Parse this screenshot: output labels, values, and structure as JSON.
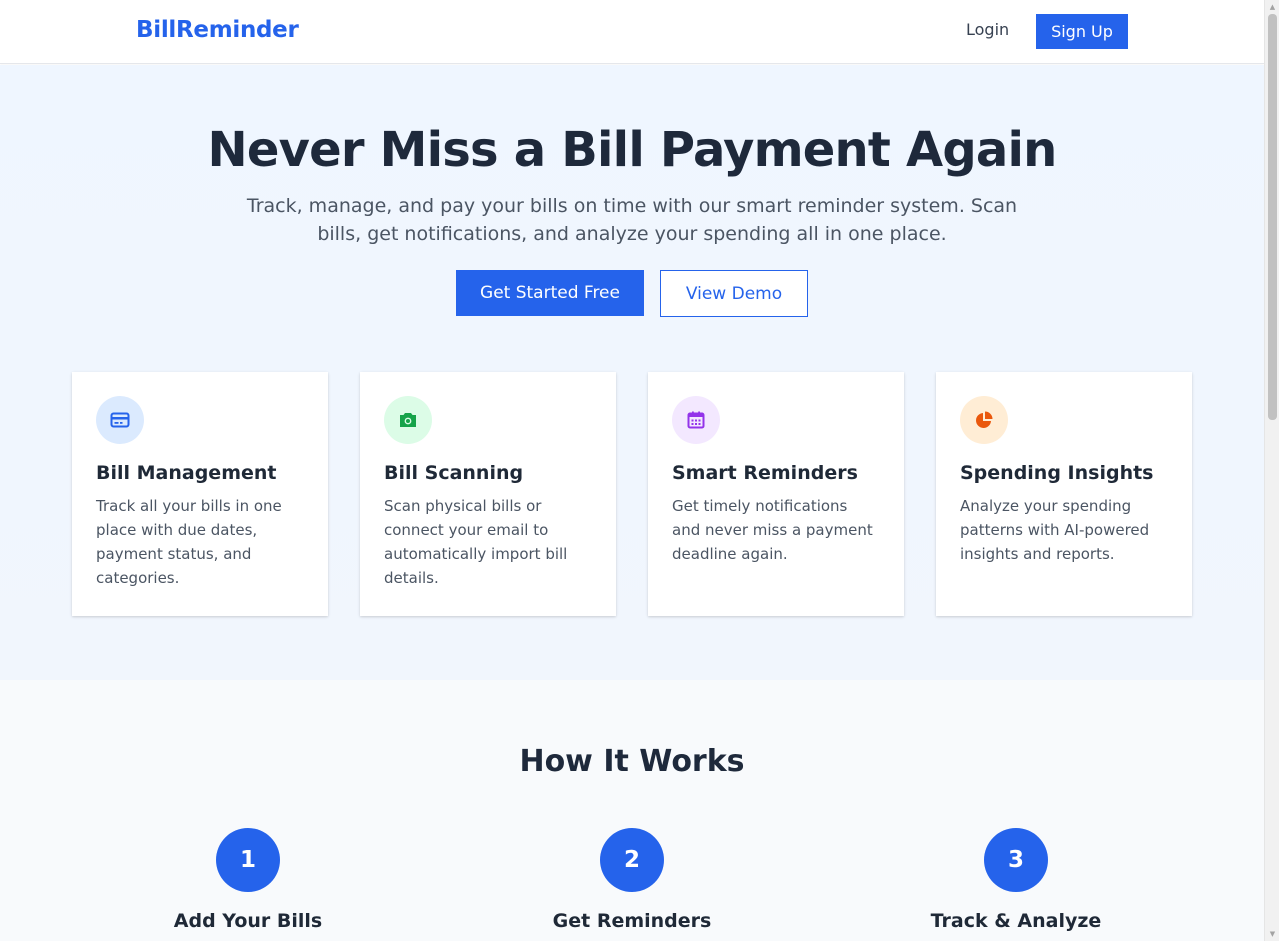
{
  "header": {
    "brand": "BillReminder",
    "login_label": "Login",
    "signup_label": "Sign Up"
  },
  "hero": {
    "title": "Never Miss a Bill Payment Again",
    "subtitle": "Track, manage, and pay your bills on time with our smart reminder system. Scan bills, get notifications, and analyze your spending all in one place.",
    "primary_cta": "Get Started Free",
    "secondary_cta": "View Demo"
  },
  "features": [
    {
      "icon": "credit-card-icon",
      "title": "Bill Management",
      "text": "Track all your bills in one place with due dates, payment status, and categories.",
      "icon_color": "#2563eb",
      "icon_bg": "#dbeafe"
    },
    {
      "icon": "camera-icon",
      "title": "Bill Scanning",
      "text": "Scan physical bills or connect your email to automatically import bill details.",
      "icon_color": "#16a34a",
      "icon_bg": "#dcfce7"
    },
    {
      "icon": "calendar-icon",
      "title": "Smart Reminders",
      "text": "Get timely notifications and never miss a payment deadline again.",
      "icon_color": "#9333ea",
      "icon_bg": "#f3e8ff"
    },
    {
      "icon": "pie-chart-icon",
      "title": "Spending Insights",
      "text": "Analyze your spending patterns with AI-powered insights and reports.",
      "icon_color": "#ea580c",
      "icon_bg": "#ffedd5"
    }
  ],
  "how_it_works": {
    "title": "How It Works",
    "steps": [
      {
        "number": "1",
        "title": "Add Your Bills"
      },
      {
        "number": "2",
        "title": "Get Reminders"
      },
      {
        "number": "3",
        "title": "Track & Analyze"
      }
    ]
  },
  "colors": {
    "primary": "#2563eb",
    "hero_bg": "#eff6ff",
    "heading": "#1e293b"
  }
}
